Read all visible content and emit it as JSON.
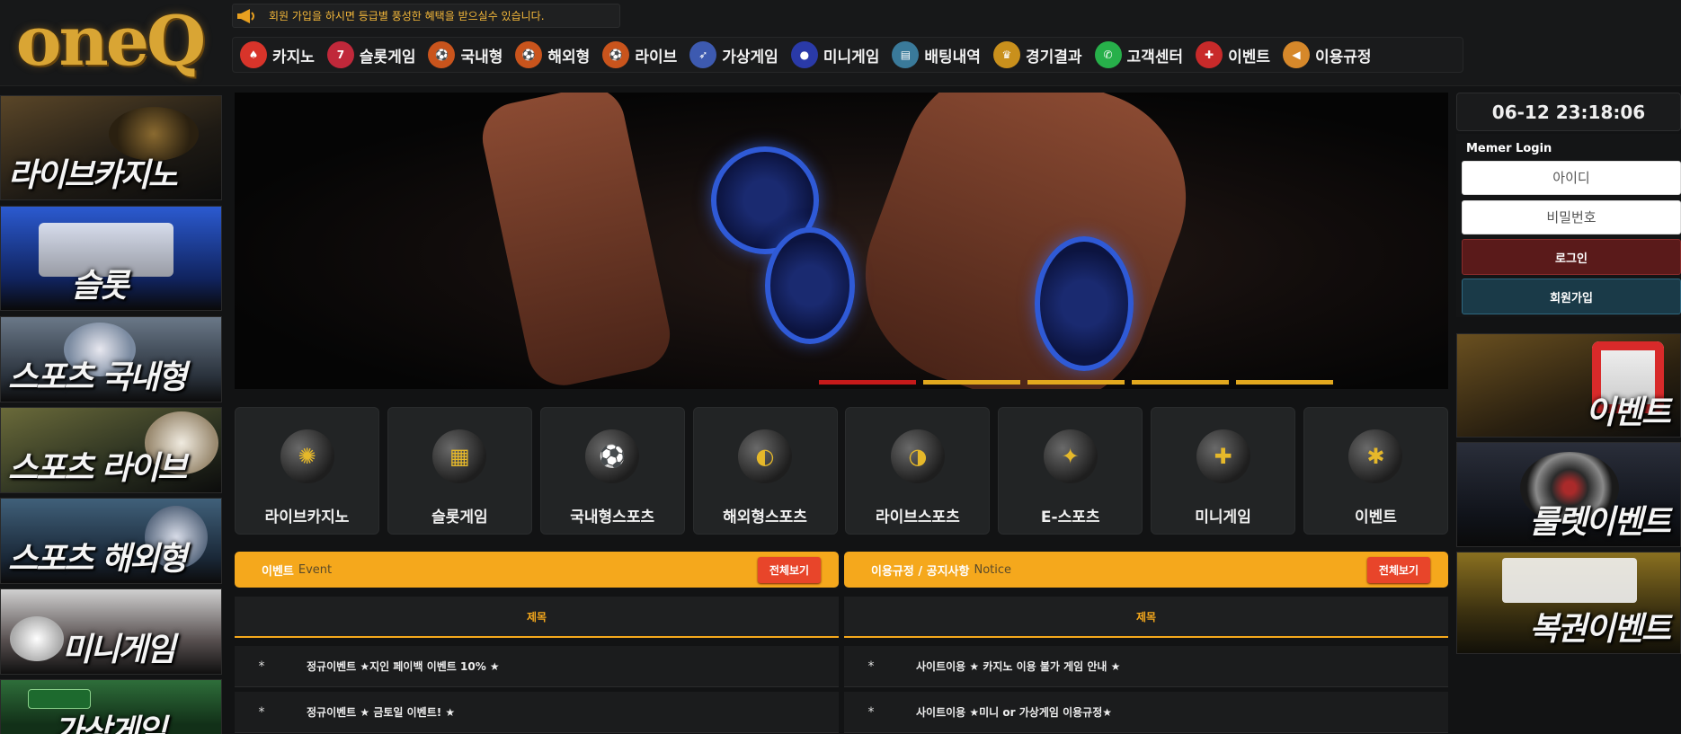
{
  "header": {
    "logo": "oneQ",
    "notice": "회원 가입을 하시면 등급별 풍성한 혜택을 받으실수 있습니다."
  },
  "nav": [
    {
      "label": "카지노",
      "icon": "casino-chip-icon",
      "color": "#d8342a"
    },
    {
      "label": "슬롯게임",
      "icon": "slot-machine-icon",
      "color": "#c0283a"
    },
    {
      "label": "국내형",
      "icon": "sports-balls-icon",
      "color": "#c9541c"
    },
    {
      "label": "해외형",
      "icon": "sports-balls-icon",
      "color": "#c9541c"
    },
    {
      "label": "라이브",
      "icon": "sports-balls-icon",
      "color": "#c9541c"
    },
    {
      "label": "가상게임",
      "icon": "virtual-race-icon",
      "color": "#3d5ab0"
    },
    {
      "label": "미니게임",
      "icon": "powerball-icon",
      "color": "#2a3aa8"
    },
    {
      "label": "배팅내역",
      "icon": "betting-history-icon",
      "color": "#3a7a9a"
    },
    {
      "label": "경기결과",
      "icon": "trophy-icon",
      "color": "#c9901c"
    },
    {
      "label": "고객센터",
      "icon": "whatsapp-icon",
      "color": "#27b04a"
    },
    {
      "label": "이벤트",
      "icon": "gift-icon",
      "color": "#c82a2a"
    },
    {
      "label": "이용규정",
      "icon": "megaphone-icon",
      "color": "#d6882a"
    }
  ],
  "left_banners": [
    {
      "label": "라이브카지노",
      "bg": "#3a3020"
    },
    {
      "label": "슬롯",
      "bg": "#1f3f8a"
    },
    {
      "label": "스포츠 국내형",
      "bg": "#3a4a5a"
    },
    {
      "label": "스포츠 라이브",
      "bg": "#3a4a30"
    },
    {
      "label": "스포츠 해외형",
      "bg": "#2a3a50"
    },
    {
      "label": "미니게임",
      "bg": "#403838"
    },
    {
      "label": "가상게임",
      "bg": "#244a2a"
    }
  ],
  "hero": {
    "slides": 5,
    "active_slide": 0
  },
  "categories": [
    {
      "label": "라이브카지노",
      "icon": "roulette-icon",
      "glyph": "✺"
    },
    {
      "label": "슬롯게임",
      "icon": "slot-machine-icon",
      "glyph": "▦"
    },
    {
      "label": "국내형스포츠",
      "icon": "soccer-ball-icon",
      "glyph": "⚽"
    },
    {
      "label": "해외형스포츠",
      "icon": "football-helmet-icon",
      "glyph": "◐"
    },
    {
      "label": "라이브스포츠",
      "icon": "racing-helmet-icon",
      "glyph": "◑"
    },
    {
      "label": "E-스포츠",
      "icon": "gamepad-icon",
      "glyph": "✦"
    },
    {
      "label": "미니게임",
      "icon": "controller-icon",
      "glyph": "✚"
    },
    {
      "label": "이벤트",
      "icon": "gift-box-icon",
      "glyph": "✱"
    }
  ],
  "event_board": {
    "title": "이벤트",
    "subtitle": "Event",
    "view_all": "전체보기",
    "column": "제목",
    "rows": [
      {
        "star": "*",
        "title": "정규이벤트 ★지인 페이백 이벤트 10% ★"
      },
      {
        "star": "*",
        "title": "정규이벤트 ★ 금토일 이벤트! ★"
      }
    ]
  },
  "notice_board": {
    "title": "이용규정 / 공지사항",
    "subtitle": "Notice",
    "view_all": "전체보기",
    "column": "제목",
    "rows": [
      {
        "star": "*",
        "title": "사이트이용 ★ 카지노 이용 불가 게임 안내 ★"
      },
      {
        "star": "*",
        "title": "사이트이용 ★미니 or 가상게임 이용규정★"
      }
    ]
  },
  "clock": "06-12 23:18:06",
  "login": {
    "title": "Memer Login",
    "id_placeholder": "아이디",
    "pw_placeholder": "비밀번호",
    "login_label": "로그인",
    "join_label": "회원가입"
  },
  "right_banners": [
    {
      "label": "이벤트",
      "bg": "#3a2a10"
    },
    {
      "label": "룰렛이벤트",
      "bg": "#1a1e2a"
    },
    {
      "label": "복권이벤트",
      "bg": "#3a3010"
    }
  ]
}
